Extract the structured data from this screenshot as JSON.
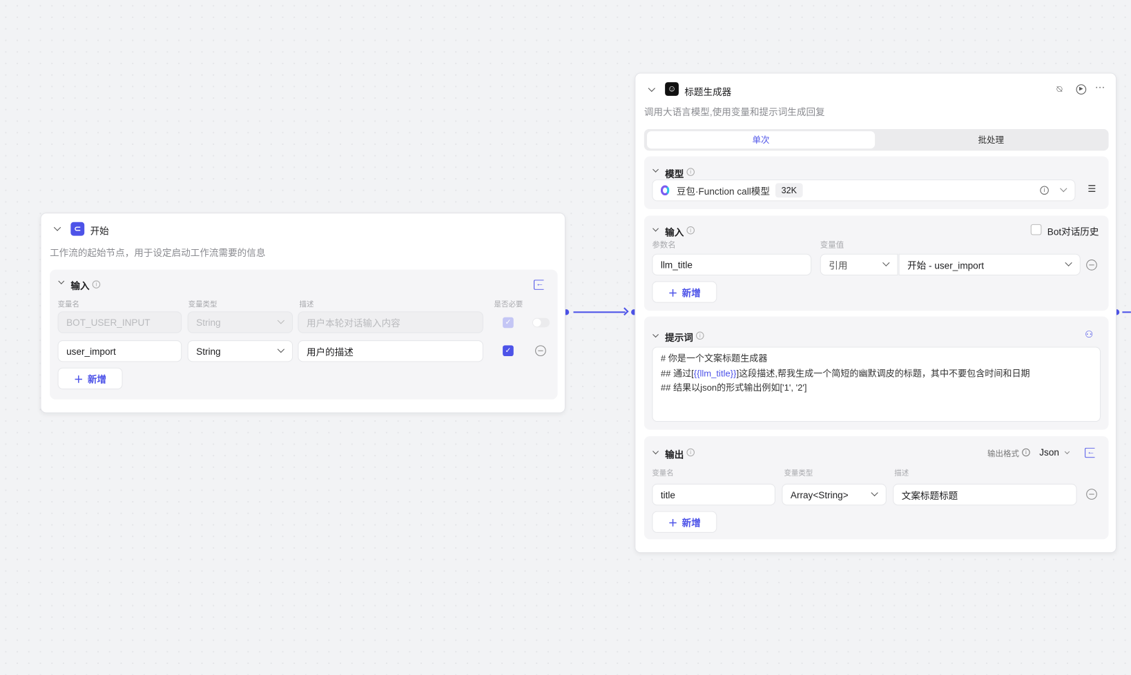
{
  "start_node": {
    "title": "开始",
    "description": "工作流的起始节点，用于设定启动工作流需要的信息",
    "input_section": {
      "title": "输入",
      "columns": [
        "变量名",
        "变量类型",
        "描述",
        "是否必要"
      ],
      "rows": [
        {
          "name": "BOT_USER_INPUT",
          "type": "String",
          "description_placeholder": "用户本轮对话输入内容",
          "required": true,
          "disabled": true
        },
        {
          "name": "user_import",
          "type": "String",
          "description": "用户的描述",
          "required": true,
          "disabled": false
        }
      ],
      "add_label": "新增"
    }
  },
  "llm_node": {
    "title": "标题生成器",
    "description": "调用大语言模型,使用变量和提示词生成回复",
    "tabs": [
      {
        "label": "单次",
        "active": true
      },
      {
        "label": "批处理",
        "active": false
      }
    ],
    "model_section": {
      "title": "模型",
      "model_name": "豆包·Function call模型",
      "context_badge": "32K"
    },
    "input_section": {
      "title": "输入",
      "bot_history_label": "Bot对话历史",
      "bot_history_checked": false,
      "columns": [
        "参数名",
        "变量值"
      ],
      "rows": [
        {
          "name": "llm_title",
          "value_type": "引用",
          "value": "开始 - user_import"
        }
      ],
      "add_label": "新增"
    },
    "prompt_section": {
      "title": "提示词",
      "lines": [
        {
          "before": "# 你是一个文案标题生成器",
          "var": "",
          "after": ""
        },
        {
          "before": "## 通过[",
          "var": "{{llm_title}}",
          "after": "]这段描述,帮我生成一个简短的幽默调皮的标题，其中不要包含时间和日期"
        },
        {
          "before": "## 结果以json的形式输出例如['1', '2']",
          "var": "",
          "after": ""
        }
      ]
    },
    "output_section": {
      "title": "输出",
      "format_label": "输出格式",
      "format_value": "Json",
      "columns": [
        "变量名",
        "变量类型",
        "描述"
      ],
      "rows": [
        {
          "name": "title",
          "type": "Array<String>",
          "description": "文案标题标题"
        }
      ],
      "add_label": "新增"
    }
  },
  "colors": {
    "accent": "#4d53e8",
    "canvas": "#f2f3f5"
  }
}
